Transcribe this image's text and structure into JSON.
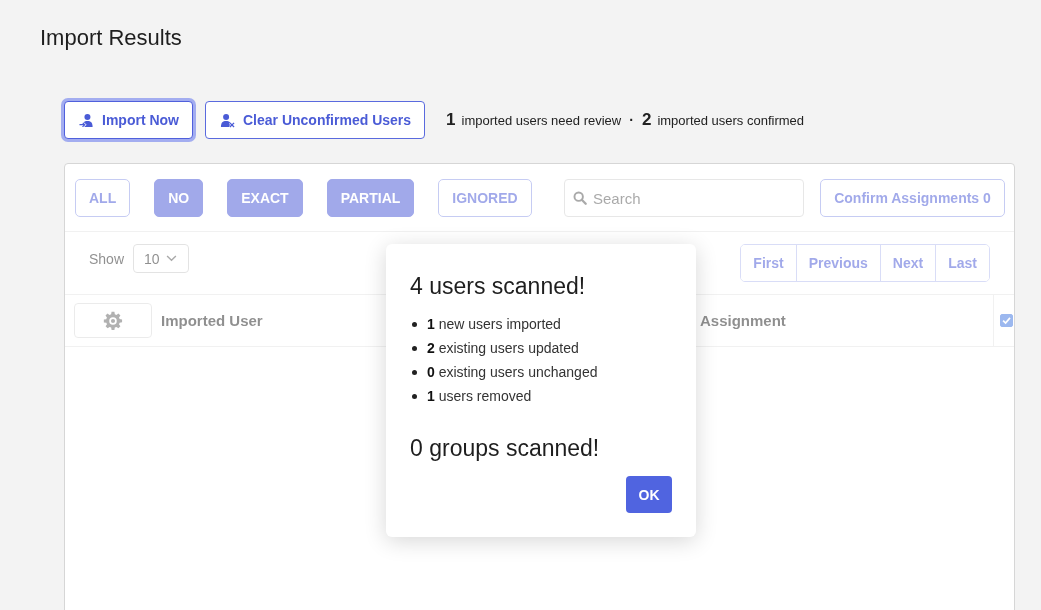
{
  "page": {
    "title": "Import Results"
  },
  "toolbar": {
    "buttons": [
      {
        "label": "Import Now",
        "kind": "import",
        "focused": true
      },
      {
        "label": "Clear Unconfirmed Users",
        "kind": "clear",
        "focused": false
      }
    ],
    "summary": [
      {
        "count": "1",
        "label": "imported users need review"
      },
      {
        "count": "2",
        "label": "imported users confirmed"
      }
    ],
    "separator": "·"
  },
  "panel": {
    "dimmed": true,
    "filters": [
      {
        "label": "ALL",
        "selected": false
      },
      {
        "label": "NO",
        "selected": true
      },
      {
        "label": "EXACT",
        "selected": true
      },
      {
        "label": "PARTIAL",
        "selected": true
      },
      {
        "label": "IGNORED",
        "selected": false
      }
    ],
    "search": {
      "placeholder": "Search"
    },
    "confirm_button": "Confirm Assignments 0",
    "page_size": {
      "label": "Show",
      "value": "10"
    },
    "pagination": [
      "First",
      "Previous",
      "Next",
      "Last"
    ],
    "table": {
      "columns": [
        {
          "kind": "settings"
        },
        {
          "kind": "text",
          "label": "Imported User"
        },
        {
          "kind": "text",
          "label": "Assignment"
        },
        {
          "kind": "checkbox",
          "checked": true
        }
      ]
    }
  },
  "dialog": {
    "title": "4 users scanned!",
    "items": [
      "**1** new users imported",
      "**2** existing users updated",
      "**0** existing users unchanged",
      "**1** users removed"
    ],
    "subtitle": "0 groups scanned!",
    "button": "OK"
  }
}
